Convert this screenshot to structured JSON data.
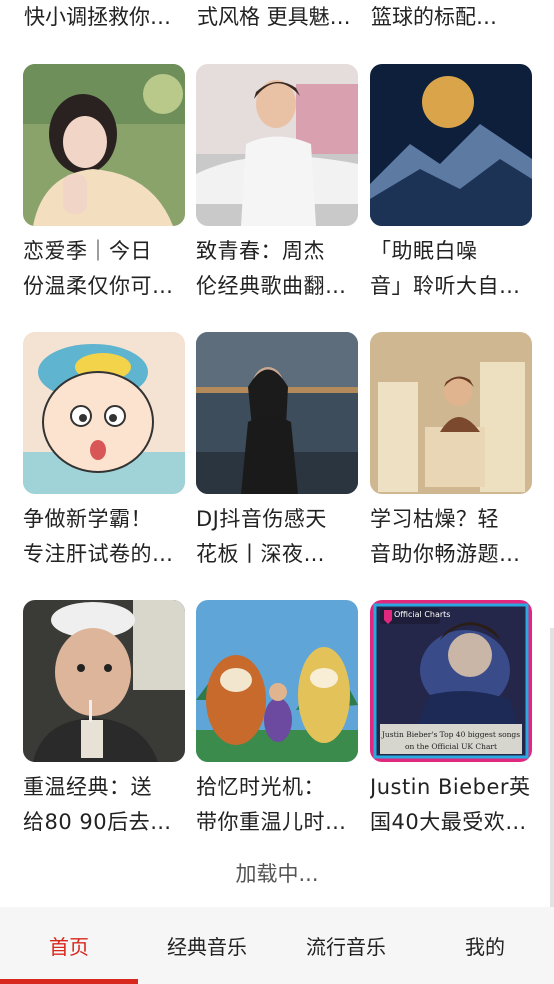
{
  "top_row": [
    {
      "title": "快小调拯救你…"
    },
    {
      "title": "式风格 更具魅…"
    },
    {
      "title": "篮球的标配…"
    }
  ],
  "cards": [
    {
      "line1": "恋爱季｜今日",
      "line2": "份温柔仅你可…",
      "thumb": "girl-portrait-image"
    },
    {
      "line1": "致青春：周杰",
      "line2": "伦经典歌曲翻…",
      "thumb": "singer-car-image"
    },
    {
      "line1": "「助眠白噪",
      "line2": "音」聆听大自…",
      "thumb": "moon-mountain-image"
    },
    {
      "line1": "争做新学霸！",
      "line2": "专注肝试卷的…",
      "thumb": "cartoon-boy-image"
    },
    {
      "line1": "DJ抖音伤感天",
      "line2": "花板丨深夜…",
      "thumb": "night-woman-image"
    },
    {
      "line1": "学习枯燥？轻",
      "line2": "音助你畅游题…",
      "thumb": "study-books-image"
    },
    {
      "line1": "重温经典：送",
      "line2": "给80 90后去…",
      "thumb": "man-drink-image"
    },
    {
      "line1": "拾忆时光机：",
      "line2": "带你重温儿时…",
      "thumb": "cartoon-bears-image"
    },
    {
      "line1": "Justin Bieber英",
      "line2": "国40大最受欢…",
      "thumb": "official-charts-image"
    }
  ],
  "chart_cover": {
    "badge": "Official Charts",
    "caption_line1": "Justin Bieber's Top 40 biggest songs",
    "caption_line2": "on the Official UK Chart"
  },
  "loading_text": "加载中...",
  "tabs": [
    {
      "label": "首页",
      "active": true
    },
    {
      "label": "经典音乐",
      "active": false
    },
    {
      "label": "流行音乐",
      "active": false
    },
    {
      "label": "我的",
      "active": false
    }
  ],
  "colors": {
    "accent": "#d8271c",
    "tabbar_bg": "#f6f6f6"
  }
}
